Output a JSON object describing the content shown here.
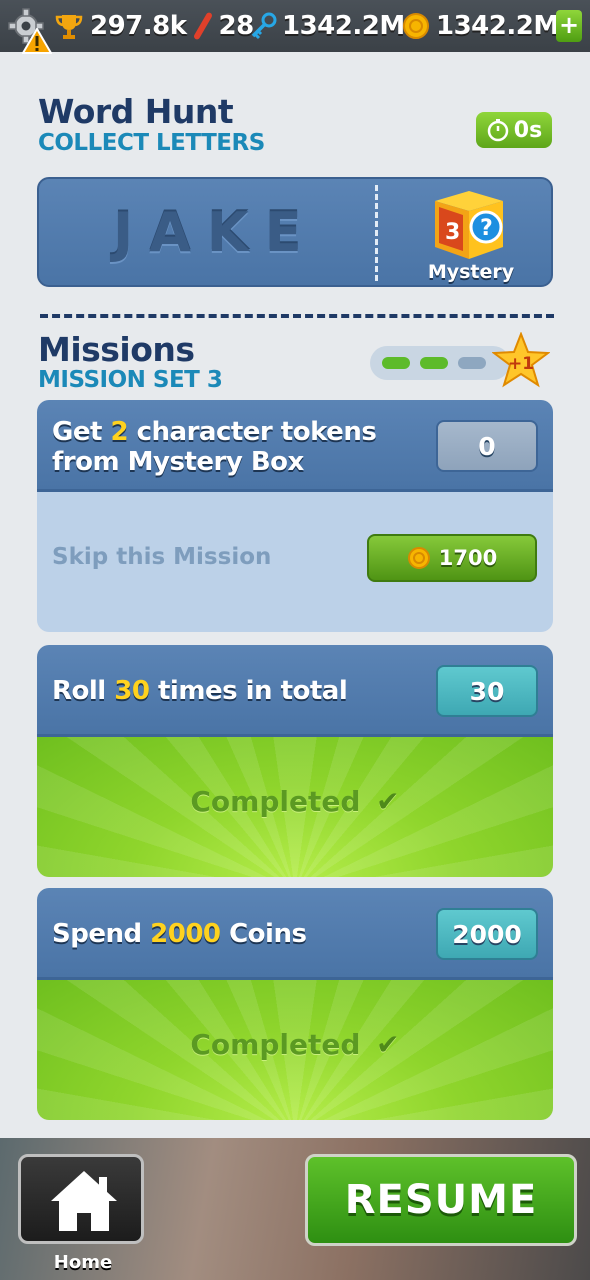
{
  "topbar": {
    "trophy_value": "297.8k",
    "streak_value": "28",
    "keys_value": "1342.2M",
    "coins_value": "1342.2M",
    "plus_label": "+"
  },
  "word_hunt": {
    "title": "Word Hunt",
    "subtitle": "COLLECT LETTERS",
    "timer": "0s",
    "word": "JAKE",
    "reward_label": "Mystery"
  },
  "missions": {
    "title": "Missions",
    "subtitle": "MISSION SET 3",
    "progress_done": 2,
    "progress_total": 3,
    "star_bonus": "+1",
    "list": [
      {
        "pre": "Get ",
        "highlight": "2",
        "post": " character tokens",
        "line2": "from Mystery Box",
        "counter": "0",
        "skip_label": "Skip this Mission",
        "skip_cost": "1700"
      },
      {
        "pre": "Roll ",
        "highlight": "30",
        "post": " times in total",
        "counter": "30",
        "status": "Completed"
      },
      {
        "pre": "Spend ",
        "highlight": "2000",
        "post": " Coins",
        "counter": "2000",
        "status": "Completed"
      }
    ]
  },
  "footer": {
    "home_label": "Home",
    "resume_label": "RESUME"
  },
  "colors": {
    "accent_green": "#5ec12a",
    "panel_blue": "#4a74a6",
    "title_navy": "#1f3a66",
    "subtitle_blue": "#1b89b8",
    "highlight_yellow": "#ffd21f"
  }
}
